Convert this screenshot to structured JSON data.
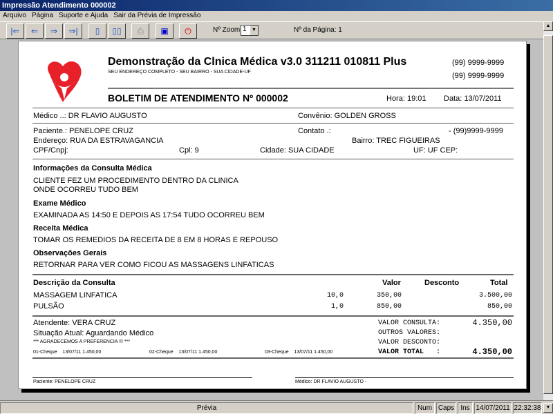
{
  "window": {
    "title": "Impressão Atendimento 000002"
  },
  "menu": [
    "Arquivo",
    "Página",
    "Suporte e Ajuda",
    "Sair da Prévia de Impressão"
  ],
  "toolbar": {
    "zoom_label": "Nº Zoom",
    "zoom_value": "1",
    "page_label": "Nº da Página: 1"
  },
  "header": {
    "clinic": "Demonstração da Clnica Médica v3.0 311211 010811 Plus",
    "address": "SEU ENDEREÇO COMPLETO - SEU BAIRRO - SUA CIDADE-UF",
    "phone1": "(99) 9999-9999",
    "phone2": "(99) 9999-9999",
    "title": "BOLETIM DE ATENDIMENTO Nº 000002",
    "hora": "Hora: 19:01",
    "data": "Data: 13/07/2011"
  },
  "info": {
    "medico": "Médico ..: DR FLAVIO AUGUSTO",
    "convenio": "Convênio: GOLDEN GROSS",
    "paciente": "Paciente.: PENELOPE CRUZ",
    "contato": "Contato .:",
    "contato_tel": "- (99)9999-9999",
    "endereco": "Endereço: RUA DA ESTRAVAGANCIA",
    "bairro": "Bairro: TREC FIGUEIRAS",
    "cpf": "CPF/Cnpj:",
    "cpl": "Cpl: 9",
    "cidade": "Cidade: SUA CIDADE",
    "uf": "UF: UF  CEP:"
  },
  "sections": [
    {
      "title": "Informações da Consulta Médica",
      "lines": [
        "CLIENTE FEZ UM PROCEDIMENTO DENTRO DA CLINICA",
        "ONDE OCORREU TUDO BEM"
      ]
    },
    {
      "title": "Exame Médico",
      "lines": [
        "EXAMINADA AS 14:50 E DEPOIS AS 17:54 TUDO OCORREU BEM"
      ]
    },
    {
      "title": "Receita Médica",
      "lines": [
        "TOMAR OS REMEDIOS DA RECEITA DE 8 EM 8 HORAS E REPOUSO"
      ]
    },
    {
      "title": "Observações Gerais",
      "lines": [
        "RETORNAR PARA VER COMO FICOU AS MASSAGENS LINFATICAS"
      ]
    }
  ],
  "table": {
    "headers": [
      "Descrição da Consulta",
      "Valor",
      "Desconto",
      "Total"
    ],
    "rows": [
      {
        "desc": "MASSAGEM LINFATICA",
        "qtd": "10,0",
        "valor": "350,00",
        "total": "3.500,00"
      },
      {
        "desc": "PULSÃO",
        "qtd": "1,0",
        "valor": "850,00",
        "total": "850,00"
      }
    ]
  },
  "footer": {
    "atendente": "Atendente: VERA CRUZ",
    "situacao": "Situação Atual: Aguardando Médico",
    "agradecimento": "*** AGRADECEMOS A PREFERENCIA !!! ***",
    "cheques": [
      {
        "n": "01-Cheque",
        "info": "13/07/11 1.450,00"
      },
      {
        "n": "02-Cheque",
        "info": "13/07/11 1.450,00"
      },
      {
        "n": "03-Cheque",
        "info": "13/07/11 1.450,00"
      }
    ],
    "valor_consulta_label": "VALOR CONSULTA:",
    "valor_consulta": "4.350,00",
    "outros_label": "OUTROS VALORES:",
    "desconto_label": "VALOR DESCONTO:",
    "total_label": "VALOR TOTAL   :",
    "total": "4.350,00",
    "sig_paciente": "Paciente: PENELOPE CRUZ",
    "sig_medico": "Médico: DR FLAVIO AUGUSTO -"
  },
  "status": {
    "main": "Prévia",
    "num": "Num",
    "caps": "Caps",
    "ins": "Ins",
    "date": "14/07/2011",
    "time": "22:32:38"
  }
}
